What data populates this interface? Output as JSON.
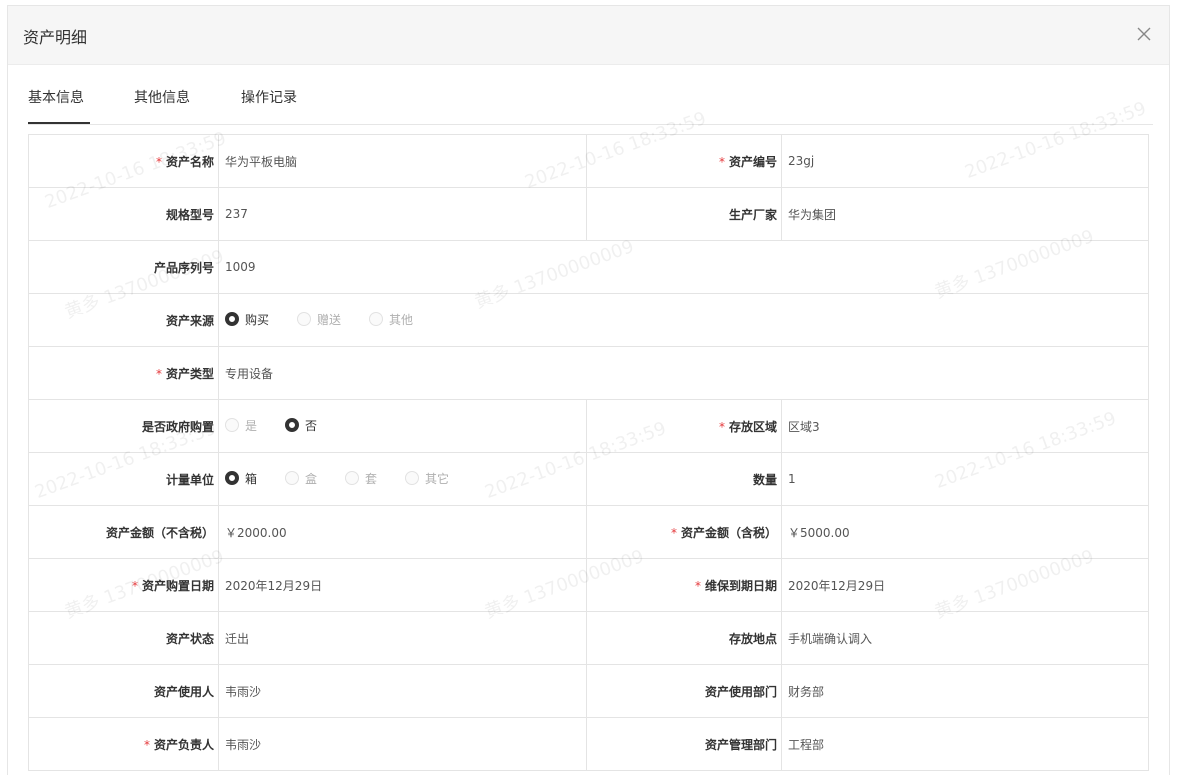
{
  "dialog": {
    "title": "资产明细"
  },
  "tabs": [
    {
      "label": "基本信息",
      "active": true
    },
    {
      "label": "其他信息",
      "active": false
    },
    {
      "label": "操作记录",
      "active": false
    }
  ],
  "fields": {
    "asset_name": {
      "label": "资产名称",
      "value": "华为平板电脑",
      "required": true
    },
    "asset_no": {
      "label": "资产编号",
      "value": "23gj",
      "required": true
    },
    "spec_model": {
      "label": "规格型号",
      "value": "237"
    },
    "manufacturer": {
      "label": "生产厂家",
      "value": "华为集团"
    },
    "serial_no": {
      "label": "产品序列号",
      "value": "1009"
    },
    "asset_source": {
      "label": "资产来源",
      "options": [
        "购买",
        "赠送",
        "其他"
      ],
      "selected": "购买"
    },
    "asset_type": {
      "label": "资产类型",
      "value": "专用设备",
      "required": true
    },
    "gov_purchase": {
      "label": "是否政府购置",
      "options": [
        "是",
        "否"
      ],
      "selected": "否"
    },
    "storage_area": {
      "label": "存放区域",
      "value": "区域3",
      "required": true
    },
    "unit": {
      "label": "计量单位",
      "options": [
        "箱",
        "盒",
        "套",
        "其它"
      ],
      "selected": "箱"
    },
    "quantity": {
      "label": "数量",
      "value": "1"
    },
    "amount_excl_tax": {
      "label": "资产金额（不含税）",
      "value": "￥2000.00"
    },
    "amount_incl_tax": {
      "label": "资产金额（含税）",
      "value": "￥5000.00",
      "required": true
    },
    "purchase_date": {
      "label": "资产购置日期",
      "value": "2020年12月29日",
      "required": true
    },
    "warranty_date": {
      "label": "维保到期日期",
      "value": "2020年12月29日",
      "required": true
    },
    "asset_status": {
      "label": "资产状态",
      "value": "迁出"
    },
    "storage_location": {
      "label": "存放地点",
      "value": "手机端确认调入"
    },
    "asset_user": {
      "label": "资产使用人",
      "value": "韦雨沙"
    },
    "user_dept": {
      "label": "资产使用部门",
      "value": "财务部"
    },
    "asset_owner": {
      "label": "资产负责人",
      "value": "韦雨沙",
      "required": true
    },
    "manage_dept": {
      "label": "资产管理部门",
      "value": "工程部"
    }
  },
  "required_mark": "*",
  "watermarks": [
    "2022-10-16 18:33:59",
    "黄多 13700000009",
    "2022-10-16 18:33:59",
    "黄多 13700000009",
    "2022-10-16 18:33:59",
    "黄多 13700000009",
    "2022-10-16 18:33:59",
    "黄多 13700000009",
    "2022-10-16 18:33:59",
    "黄多 13700000009",
    "2022-10-16 18:33:59",
    "黄多 13700000009"
  ]
}
